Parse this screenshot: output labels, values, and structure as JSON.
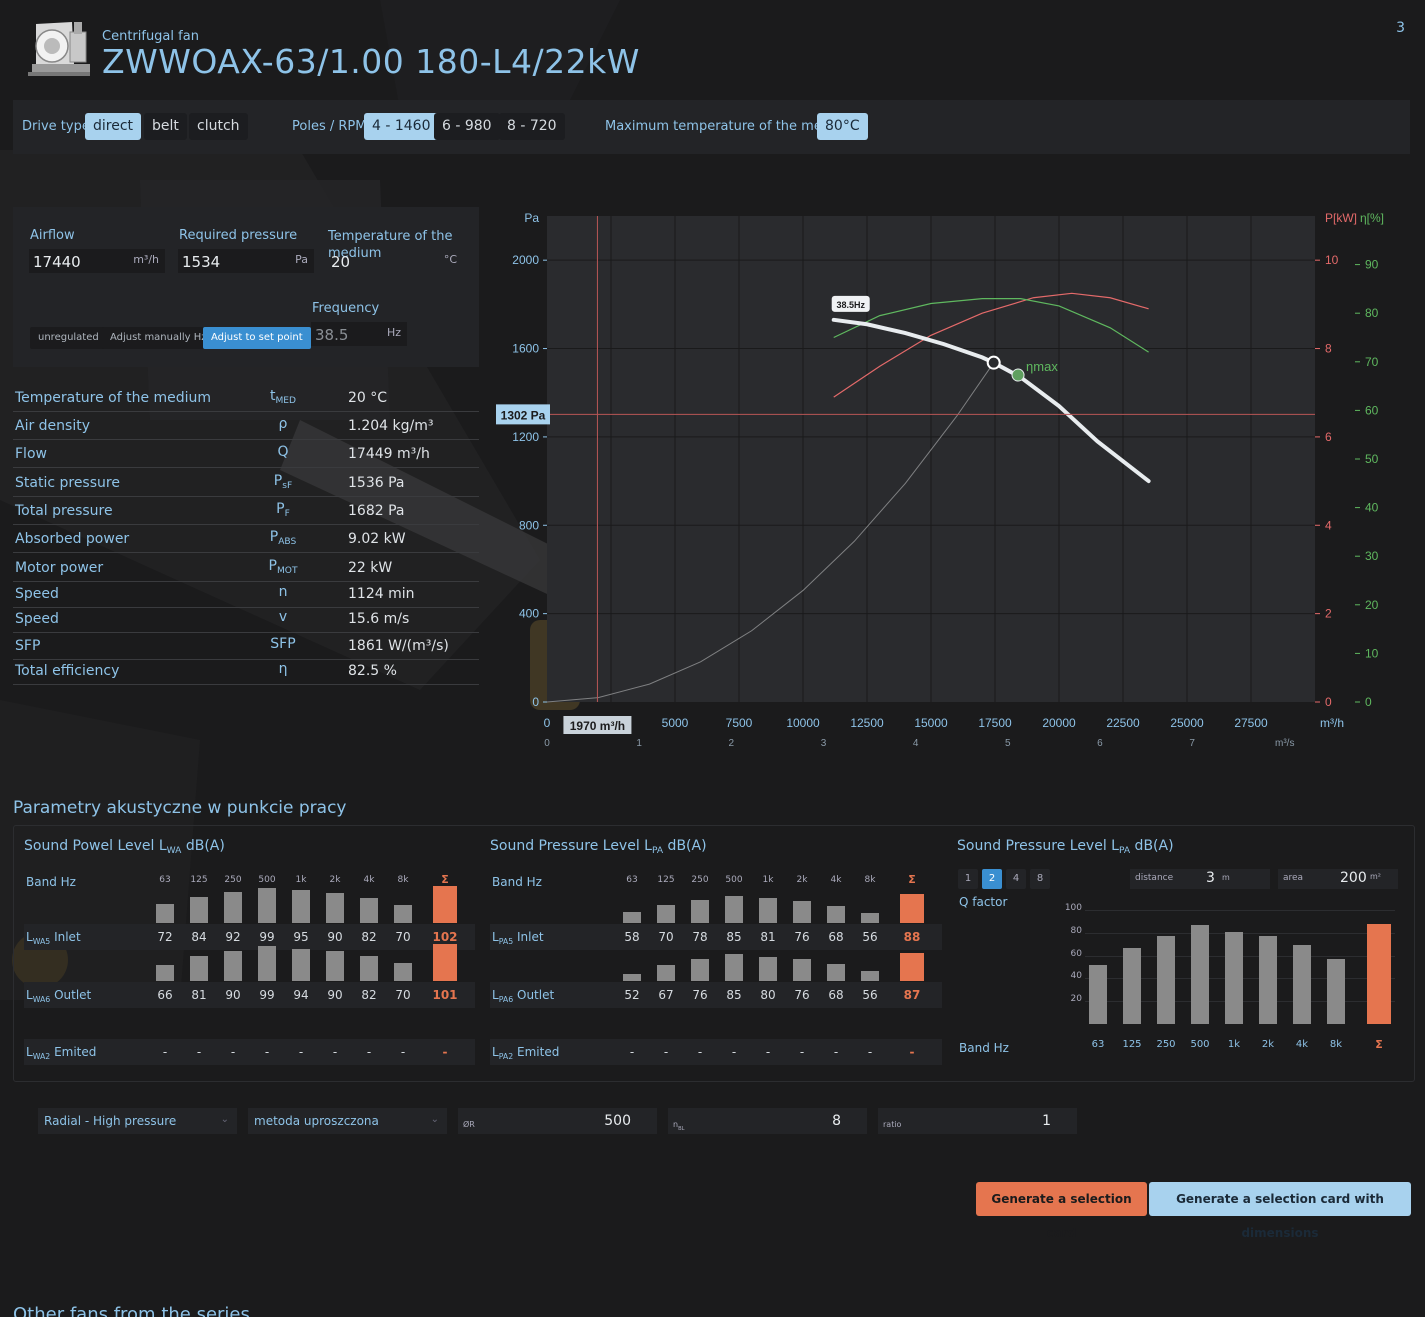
{
  "header": {
    "subtitle": "Centrifugal fan",
    "title": "ZWWOAX-63/1.00 180-L4/22kW",
    "page_number": "3"
  },
  "toolbar": {
    "drive_label": "Drive type",
    "drive_options": [
      "direct",
      "belt",
      "clutch"
    ],
    "drive_selected": "direct",
    "poles_label": "Poles / RPM",
    "poles_options": [
      "4 - 1460",
      "6 - 980",
      "8 - 720"
    ],
    "poles_selected": "4 - 1460",
    "maxtemp_label": "Maximum temperature of the medium",
    "maxtemp_value": "80°C"
  },
  "inputs": {
    "airflow_label": "Airflow",
    "airflow_value": "17440",
    "airflow_unit": "m³/h",
    "pressure_label": "Required pressure",
    "pressure_value": "1534",
    "pressure_unit": "Pa",
    "temp_label": "Temperature of the medium",
    "temp_value": "20",
    "temp_unit": "°C",
    "freq_label": "Frequency",
    "freq_value": "38.5",
    "freq_unit": "Hz",
    "modes": [
      "unregulated",
      "Adjust manually Hz",
      "Adjust to set point"
    ],
    "mode_selected": "Adjust to set point"
  },
  "properties": [
    {
      "name": "Temperature of the medium",
      "sym": "t",
      "sub": "MED",
      "value": "20",
      "unit": "°C"
    },
    {
      "name": "Air density",
      "sym": "ρ",
      "sub": "",
      "value": "1.204",
      "unit": "kg/m³"
    },
    {
      "name": "Flow",
      "sym": "Q",
      "sub": "",
      "value": "17449",
      "unit": "m³/h"
    },
    {
      "name": "Static pressure",
      "sym": "P",
      "sub": "sF",
      "value": "1536",
      "unit": "Pa"
    },
    {
      "name": "Total pressure",
      "sym": "P",
      "sub": "F",
      "value": "1682",
      "unit": "Pa"
    },
    {
      "name": "Absorbed power",
      "sym": "P",
      "sub": "ABS",
      "value": "9.02",
      "unit": "kW"
    },
    {
      "name": "Motor power",
      "sym": "P",
      "sub": "MOT",
      "value": "22",
      "unit": "kW"
    },
    {
      "name": "Speed",
      "sym": "n",
      "sub": "",
      "value": "1124",
      "unit": "min"
    },
    {
      "name": "Speed",
      "sym": "v",
      "sub": "",
      "value": "15.6",
      "unit": "m/s"
    },
    {
      "name": "SFP",
      "sym": "SFP",
      "sub": "",
      "value": "1861",
      "unit": "W/(m³/s)"
    },
    {
      "name": "Total efficiency",
      "sym": "η",
      "sub": "",
      "value": "82.5",
      "unit": "%"
    }
  ],
  "chart_data": {
    "type": "line",
    "x_unit": "m³/h",
    "x2_unit": "m³/s",
    "y_unit": "Pa",
    "y2_unit": "P[kW]",
    "y3_unit": "η[%]",
    "xlim": [
      0,
      30000
    ],
    "ylim": [
      0,
      2200
    ],
    "y2lim": [
      0,
      11
    ],
    "y3lim": [
      0,
      100
    ],
    "x_ticks": [
      0,
      5000,
      7500,
      10000,
      12500,
      15000,
      17500,
      20000,
      22500,
      25000,
      27500
    ],
    "x2_ticks": [
      0,
      1,
      2,
      3,
      4,
      5,
      6,
      7
    ],
    "y_ticks": [
      0,
      400,
      800,
      1200,
      1600,
      2000
    ],
    "y2_ticks": [
      0,
      2,
      4,
      6,
      8,
      10
    ],
    "y3_ticks": [
      0,
      10,
      20,
      30,
      40,
      50,
      60,
      70,
      80,
      90
    ],
    "cursor_x_label": "1970 m³/h",
    "cursor_y_label": "1302 Pa",
    "cursor": {
      "x": 1970,
      "y": 1302
    },
    "curve_label": "38.5Hz",
    "eta_label": "ηmax",
    "fan_curve": {
      "x": [
        11200,
        12500,
        14000,
        15500,
        17000,
        17449,
        18500,
        20000,
        21500,
        23500
      ],
      "y": [
        1730,
        1710,
        1670,
        1620,
        1560,
        1536,
        1470,
        1340,
        1180,
        1000
      ]
    },
    "system_curve": {
      "x": [
        0,
        2000,
        4000,
        6000,
        8000,
        10000,
        12000,
        14000,
        16000,
        17449
      ],
      "y": [
        0,
        20,
        81,
        182,
        323,
        505,
        727,
        990,
        1293,
        1536
      ]
    },
    "operating_point": {
      "x": 17449,
      "y": 1536
    },
    "eta_max_point": {
      "x": 18400,
      "y": 1480
    },
    "power_curve": {
      "x": [
        11200,
        13000,
        15000,
        17000,
        19000,
        20500,
        22000,
        23500
      ],
      "y": [
        6.9,
        7.6,
        8.3,
        8.8,
        9.15,
        9.25,
        9.15,
        8.9
      ]
    },
    "efficiency_curve": {
      "x": [
        11200,
        13000,
        15000,
        17000,
        18500,
        20000,
        22000,
        23500
      ],
      "y": [
        75,
        79.5,
        82,
        83,
        83,
        81.5,
        77,
        72
      ]
    }
  },
  "acoustics": {
    "title": "Parametry akustyczne w punkcie pracy",
    "lwa_title": "Sound Powel Level L",
    "lwa_sub": "WA",
    "lpa_title": "Sound Pressure Level L",
    "lpa_sub": "PA",
    "unit": "dB(A)",
    "band_label": "Band Hz",
    "bands": [
      "63",
      "125",
      "250",
      "500",
      "1k",
      "2k",
      "4k",
      "8k"
    ],
    "sum_symbol": "Σ",
    "lwa_rows": [
      {
        "prefix": "L",
        "sub": "WA5",
        "label": "Inlet",
        "values": [
          72,
          84,
          92,
          99,
          95,
          90,
          82,
          70
        ],
        "sum": "102"
      },
      {
        "prefix": "L",
        "sub": "WA6",
        "label": "Outlet",
        "values": [
          66,
          81,
          90,
          99,
          94,
          90,
          82,
          70
        ],
        "sum": "101"
      },
      {
        "prefix": "L",
        "sub": "WA2",
        "label": "Emited",
        "values": [
          "-",
          "-",
          "-",
          "-",
          "-",
          "-",
          "-",
          "-"
        ],
        "sum": "-"
      }
    ],
    "lpa_rows": [
      {
        "prefix": "L",
        "sub": "PA5",
        "label": "Inlet",
        "values": [
          58,
          70,
          78,
          85,
          81,
          76,
          68,
          56
        ],
        "sum": "88"
      },
      {
        "prefix": "L",
        "sub": "PA6",
        "label": "Outlet",
        "values": [
          52,
          67,
          76,
          85,
          80,
          76,
          68,
          56
        ],
        "sum": "87"
      },
      {
        "prefix": "L",
        "sub": "PA2",
        "label": "Emited",
        "values": [
          "-",
          "-",
          "-",
          "-",
          "-",
          "-",
          "-",
          "-"
        ],
        "sum": "-"
      }
    ],
    "q_options": [
      "1",
      "2",
      "4",
      "8"
    ],
    "q_selected": "2",
    "q_label": "Q factor",
    "distance_label": "distance",
    "distance_value": "3",
    "distance_unit": "m",
    "area_label": "area",
    "area_value": "200",
    "area_unit": "m²",
    "spectrum_values": [
      52,
      67,
      77,
      87,
      81,
      77,
      69,
      57
    ],
    "spectrum_sum": 88,
    "spectrum_ticks": [
      "100",
      "80",
      "60",
      "40",
      "20"
    ]
  },
  "bottom": {
    "select1": "Radial - High pressure",
    "select2": "metoda uproszczona",
    "dr_label": "ØR",
    "dr_value": "500",
    "nbl_label": "n",
    "nbl_sub": "BL",
    "nbl_value": "8",
    "ratio_label": "ratio",
    "ratio_value": "1",
    "btn_card": "Generate a selection card",
    "btn_card_dim": "Generate a selection card with dimensions",
    "footer": "Other fans from the series"
  }
}
